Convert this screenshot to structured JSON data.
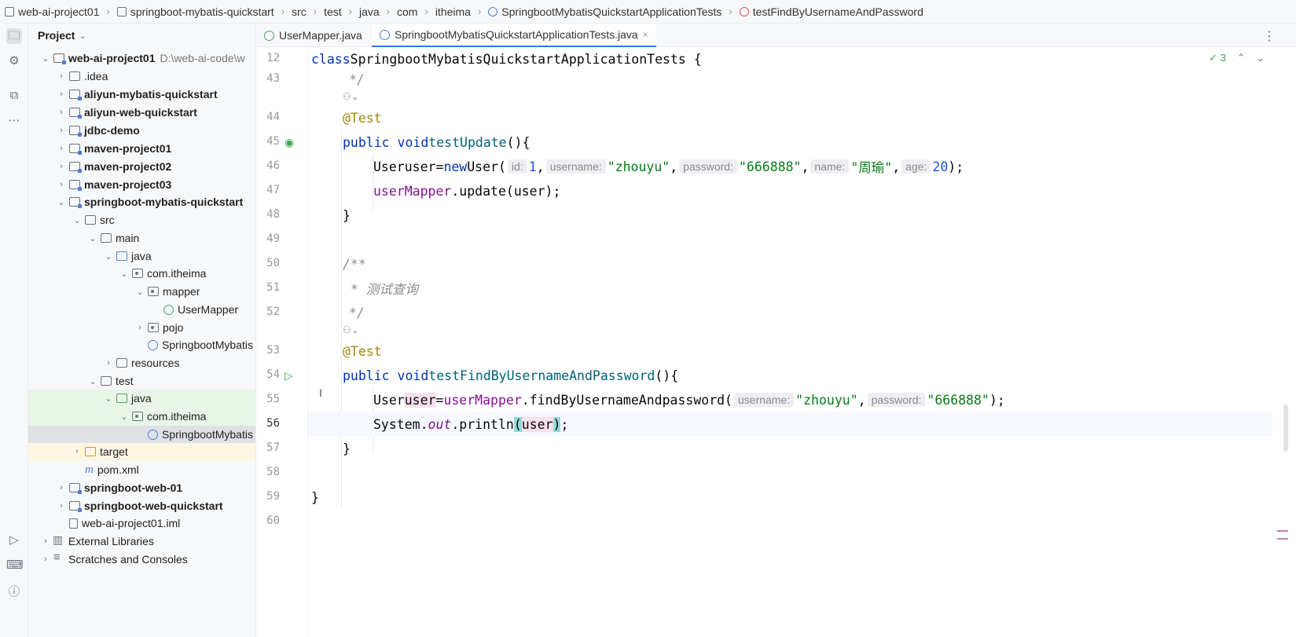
{
  "breadcrumb": [
    "web-ai-project01",
    "springboot-mybatis-quickstart",
    "src",
    "test",
    "java",
    "com",
    "itheima",
    "SpringbootMybatisQuickstartApplicationTests",
    "testFindByUsernameAndPassword"
  ],
  "project_panel": {
    "title": "Project",
    "root": {
      "name": "web-ai-project01",
      "path": "D:\\web-ai-code\\w"
    },
    "items": {
      "idea": ".idea",
      "aliyun_mybatis": "aliyun-mybatis-quickstart",
      "aliyun_web": "aliyun-web-quickstart",
      "jdbc": "jdbc-demo",
      "maven1": "maven-project01",
      "maven2": "maven-project02",
      "maven3": "maven-project03",
      "sbmq": "springboot-mybatis-quickstart",
      "src": "src",
      "main": "main",
      "java_main": "java",
      "pkg_main": "com.itheima",
      "mapper": "mapper",
      "usermapper": "UserMapper",
      "pojo": "pojo",
      "sbm_app": "SpringbootMybatis",
      "resources": "resources",
      "test": "test",
      "java_test": "java",
      "pkg_test": "com.itheima",
      "sbm_test": "SpringbootMybatis",
      "target": "target",
      "pom": "pom.xml",
      "sbw01": "springboot-web-01",
      "sbwq": "springboot-web-quickstart",
      "iml": "web-ai-project01.iml",
      "extlib": "External Libraries",
      "scratches": "Scratches and Consoles"
    }
  },
  "tabs": [
    {
      "label": "UserMapper.java",
      "active": false
    },
    {
      "label": "SpringbootMybatisQuickstartApplicationTests.java",
      "active": true
    }
  ],
  "inspection_count": "3",
  "code": {
    "ln12": "12",
    "ln43": "43",
    "ln44": "44",
    "ln45": "45",
    "ln46": "46",
    "ln47": "47",
    "ln48": "48",
    "ln49": "49",
    "ln50": "50",
    "ln51": "51",
    "ln52": "52",
    "ln53": "53",
    "ln54": "54",
    "ln55": "55",
    "ln56": "56",
    "ln57": "57",
    "ln58": "58",
    "ln59": "59",
    "ln60": "60",
    "class_kw": "class",
    "class_name": "SpringbootMybatisQuickstartApplicationTests {",
    "comment_end": "*/",
    "annotation": "@Test",
    "public_void": "public void",
    "test_update": "testUpdate",
    "open_paren_brace": "(){",
    "user_type": "User",
    "user_var": "user",
    "eq_new": "=",
    "new_kw": "new",
    "user_ctor": "User(",
    "hint_id": "id:",
    "val_id": "1",
    "hint_username": "username:",
    "val_username": "\"zhouyu\"",
    "hint_password": "password:",
    "val_password": "\"666888\"",
    "hint_name": "name:",
    "val_name": "\"周瑜\"",
    "hint_age": "age:",
    "val_age": "20",
    "close_semi": ");",
    "user_mapper": "userMapper",
    "update_call": ".update(user);",
    "close_brace": "}",
    "javadoc_open": "/**",
    "javadoc_text": "* 测试查询",
    "test_find": "testFindByUsernameAndPassword",
    "find_call": ".findByUsernameAndpassword(",
    "comma": ",",
    "system": "System.",
    "out": "out",
    "println": ".println",
    "paren_open": "(",
    "paren_close": ")",
    "semi": ";"
  }
}
